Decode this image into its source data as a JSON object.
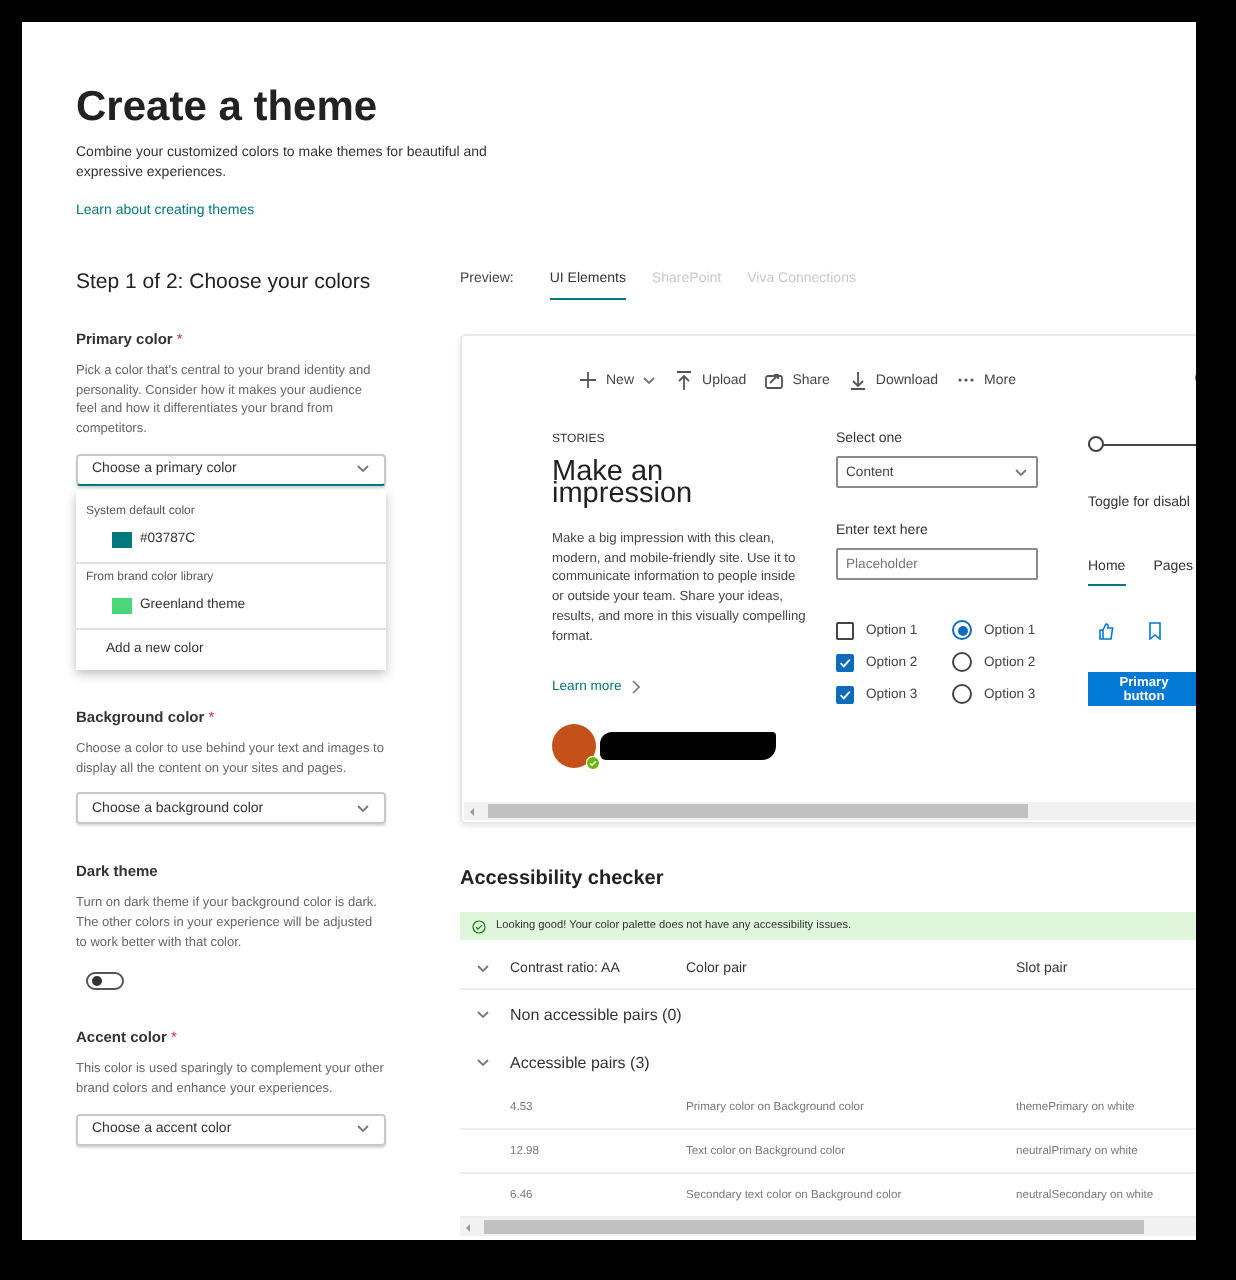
{
  "title": "Create a theme",
  "description": "Combine your customized colors to make themes for beautiful and expressive experiences.",
  "learn_link": "Learn about creating themes",
  "step_heading": "Step 1 of 2: Choose your colors",
  "settings": [
    {
      "kind": "dropdown",
      "label": "Primary color",
      "required_mark": "*",
      "description": "Pick a color that's central to your brand identity and personality. Consider how it makes your audience feel and how it differentiates your brand from competitors.",
      "placeholder": "Choose a primary color",
      "expanded": true,
      "menu": {
        "groups": [
          {
            "heading": "System default color",
            "options": [
              {
                "label": "#03787C",
                "color": "#03787c"
              }
            ]
          },
          {
            "heading": "From brand color library",
            "options": [
              {
                "label": "Greenland theme",
                "color": "#4cd67a"
              }
            ]
          }
        ],
        "action": "Add a new color"
      }
    },
    {
      "kind": "dropdown",
      "label": "Background color",
      "required_mark": "*",
      "description": "Choose a color to use behind your text and images to display all the content on your sites and pages.",
      "placeholder": "Choose a background color",
      "expanded": false
    },
    {
      "kind": "toggle",
      "label": "Dark theme",
      "description": "Turn on dark theme if your background color is dark. The other colors in your experience will be adjusted to work better with that color.",
      "on": false
    },
    {
      "kind": "dropdown",
      "label": "Accent color",
      "required_mark": "*",
      "description": "This color is used sparingly to complement your other brand colors and enhance your experiences.",
      "placeholder": "Choose a accent color",
      "expanded": false
    }
  ],
  "preview": {
    "label": "Preview:",
    "tabs": [
      {
        "label": "UI Elements",
        "selected": true
      },
      {
        "label": "SharePoint",
        "selected": false
      },
      {
        "label": "Viva Connections",
        "selected": false
      }
    ],
    "toolbar": [
      {
        "kind": "new",
        "label": "New"
      },
      {
        "kind": "upload",
        "label": "Upload"
      },
      {
        "kind": "share",
        "label": "Share"
      },
      {
        "kind": "download",
        "label": "Download"
      },
      {
        "kind": "more",
        "label": "More"
      }
    ],
    "stories": {
      "eyebrow": "STORIES",
      "heading": "Make an impression",
      "body": "Make a big impression with this clean, modern, and mobile-friendly site. Use it to communicate information to people inside or outside your team. Share your ideas, results, and more in this visually compelling format.",
      "link": "Learn more"
    },
    "select": {
      "label": "Select one",
      "value": "Content"
    },
    "text_field": {
      "label": "Enter text here",
      "placeholder": "Placeholder"
    },
    "checkboxes": [
      {
        "label": "Option 1",
        "checked": false
      },
      {
        "label": "Option 2",
        "checked": true
      },
      {
        "label": "Option 3",
        "checked": true
      }
    ],
    "radios": [
      {
        "label": "Option 1",
        "selected": true
      },
      {
        "label": "Option 2",
        "selected": false
      },
      {
        "label": "Option 3",
        "selected": false
      }
    ],
    "slider": {
      "level": 0
    },
    "toggle_label": "Toggle for disabl",
    "nav_tabs": [
      {
        "label": "Home",
        "selected": true
      },
      {
        "label": "Pages",
        "selected": false
      }
    ],
    "primary_button": "Primary button"
  },
  "checker": {
    "title": "Accessibility checker",
    "banner": "Looking good! Your color palette does not have any accessibility issues.",
    "columns": [
      "Contrast ratio: AA",
      "Color pair",
      "Slot pair"
    ],
    "groups": [
      {
        "label": "Non accessible pairs (0)"
      },
      {
        "label": "Accessible pairs (3)",
        "rows": [
          [
            "4.53",
            "Primary color on Background color",
            "themePrimary on white"
          ],
          [
            "12.98",
            "Text color on Background color",
            "neutralPrimary on white"
          ],
          [
            "6.46",
            "Secondary text color on Background color",
            "neutralSecondary on white"
          ]
        ]
      }
    ]
  }
}
